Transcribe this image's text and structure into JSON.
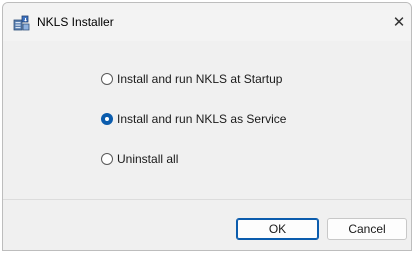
{
  "window": {
    "title": "NKLS Installer",
    "close_glyph": "✕"
  },
  "options": [
    {
      "label": "Install and run NKLS at Startup",
      "checked": false
    },
    {
      "label": "Install and run NKLS as Service",
      "checked": true
    },
    {
      "label": "Uninstall all",
      "checked": false
    }
  ],
  "buttons": {
    "ok_label": "OK",
    "cancel_label": "Cancel"
  },
  "colors": {
    "accent": "#0b5cad",
    "background": "#f0f0f0"
  },
  "icons": {
    "app": "installer-icon",
    "close": "close-icon"
  }
}
